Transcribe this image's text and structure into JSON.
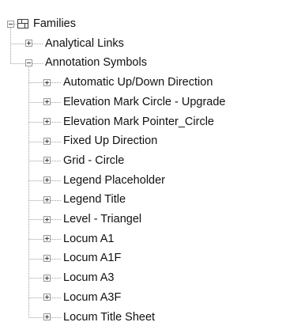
{
  "tree": {
    "root": {
      "label": "Families",
      "icon": "families-icon",
      "expanded": true
    },
    "children": [
      {
        "label": "Analytical Links",
        "expanded": false
      },
      {
        "label": "Annotation Symbols",
        "expanded": true,
        "children": [
          {
            "label": "Automatic Up/Down Direction",
            "expanded": false
          },
          {
            "label": "Elevation Mark Circle - Upgrade",
            "expanded": false
          },
          {
            "label": "Elevation Mark Pointer_Circle",
            "expanded": false
          },
          {
            "label": "Fixed Up Direction",
            "expanded": false
          },
          {
            "label": "Grid - Circle",
            "expanded": false
          },
          {
            "label": "Legend Placeholder",
            "expanded": false
          },
          {
            "label": "Legend Title",
            "expanded": false
          },
          {
            "label": "Level - Triangel",
            "expanded": false
          },
          {
            "label": "Locum A1",
            "expanded": false
          },
          {
            "label": "Locum A1F",
            "expanded": false
          },
          {
            "label": "Locum A3",
            "expanded": false
          },
          {
            "label": "Locum A3F",
            "expanded": false
          },
          {
            "label": "Locum Title Sheet",
            "expanded": false
          }
        ]
      }
    ]
  }
}
